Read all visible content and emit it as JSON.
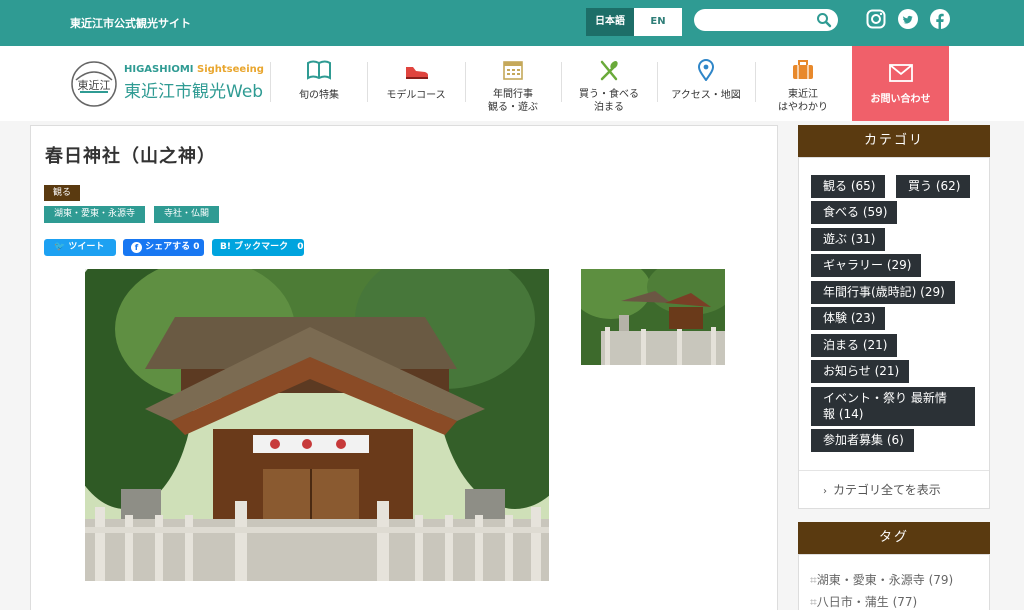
{
  "topbar": {
    "site_label": "東近江市公式観光サイト",
    "lang_ja": "日本語",
    "lang_en": "EN",
    "search_placeholder": "",
    "social_icons": [
      "instagram-icon",
      "twitter-icon",
      "facebook-icon"
    ]
  },
  "header": {
    "logo_en_a": "HIGASHIOMI",
    "logo_en_b": " Sightseeing",
    "logo_ja": "東近江市観光Web",
    "logo_emblem": "東近江",
    "nav": [
      {
        "icon": "book-icon",
        "label": "旬の特集"
      },
      {
        "icon": "shoe-icon",
        "label": "モデルコース"
      },
      {
        "icon": "calendar-icon",
        "label": "年間行事\n観る・遊ぶ"
      },
      {
        "icon": "utensils-icon",
        "label": "買う・食べる\n泊まる"
      },
      {
        "icon": "map-pin-icon",
        "label": "アクセス・地図"
      },
      {
        "icon": "suitcase-icon",
        "label": "東近江\nはやわかり"
      }
    ],
    "contact_label": "お問い合わせ",
    "colors": {
      "teal": "#2f9b93",
      "brown": "#5a3a10",
      "contact": "#f0606a",
      "dark": "#2b3136"
    }
  },
  "article": {
    "title": "春日神社（山之神）",
    "category_tag": "観る",
    "area_tags": [
      "湖東・愛東・永源寺",
      "寺社・仏閣"
    ],
    "share": {
      "tweet": "ツイート",
      "fb": "シェアする",
      "fb_count": "0",
      "hatena": "ブックマーク",
      "hatena_count": "0"
    }
  },
  "sidebar": {
    "category_title": "カテゴリ",
    "categories": [
      "観る (65)",
      "買う (62)",
      "食べる (59)",
      "遊ぶ (31)",
      "ギャラリー (29)",
      "年間行事(歳時記) (29)",
      "体験 (23)",
      "泊まる (21)",
      "お知らせ (21)",
      "イベント・祭り 最新情\n報 (14)",
      "参加者募集 (6)"
    ],
    "show_all": "カテゴリ全てを表示",
    "tag_title": "タグ",
    "tags": [
      "湖東・愛東・永源寺 (79)",
      "八日市・蒲生 (77)"
    ]
  }
}
